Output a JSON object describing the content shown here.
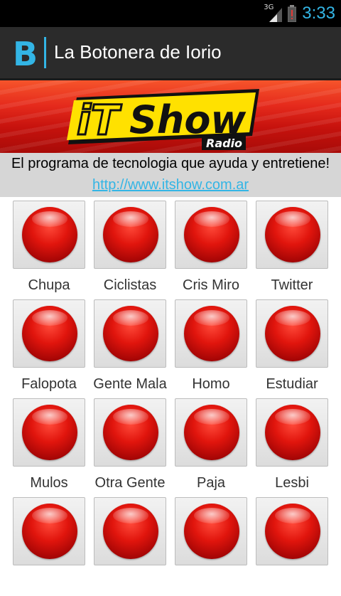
{
  "status_bar": {
    "network": "3G",
    "time": "3:33"
  },
  "action_bar": {
    "app_logo_letter": "B",
    "title": "La Botonera de Iorio"
  },
  "banner": {
    "logo_text_it": "iT",
    "logo_text_show": "Show",
    "logo_text_radio": "Radio"
  },
  "description": {
    "text": "El programa de tecnologia que ayuda y entretiene!",
    "link": "http://www.itshow.com.ar"
  },
  "buttons": [
    {
      "label": "Chupa"
    },
    {
      "label": "Ciclistas"
    },
    {
      "label": "Cris Miro"
    },
    {
      "label": "Twitter"
    },
    {
      "label": "Falopota"
    },
    {
      "label": "Gente Mala"
    },
    {
      "label": "Homo"
    },
    {
      "label": "Estudiar"
    },
    {
      "label": "Mulos"
    },
    {
      "label": "Otra Gente"
    },
    {
      "label": "Paja"
    },
    {
      "label": "Lesbi"
    },
    {
      "label": ""
    },
    {
      "label": ""
    },
    {
      "label": ""
    },
    {
      "label": ""
    }
  ],
  "colors": {
    "accent": "#33b5e5",
    "button_red": "#e1150d"
  }
}
